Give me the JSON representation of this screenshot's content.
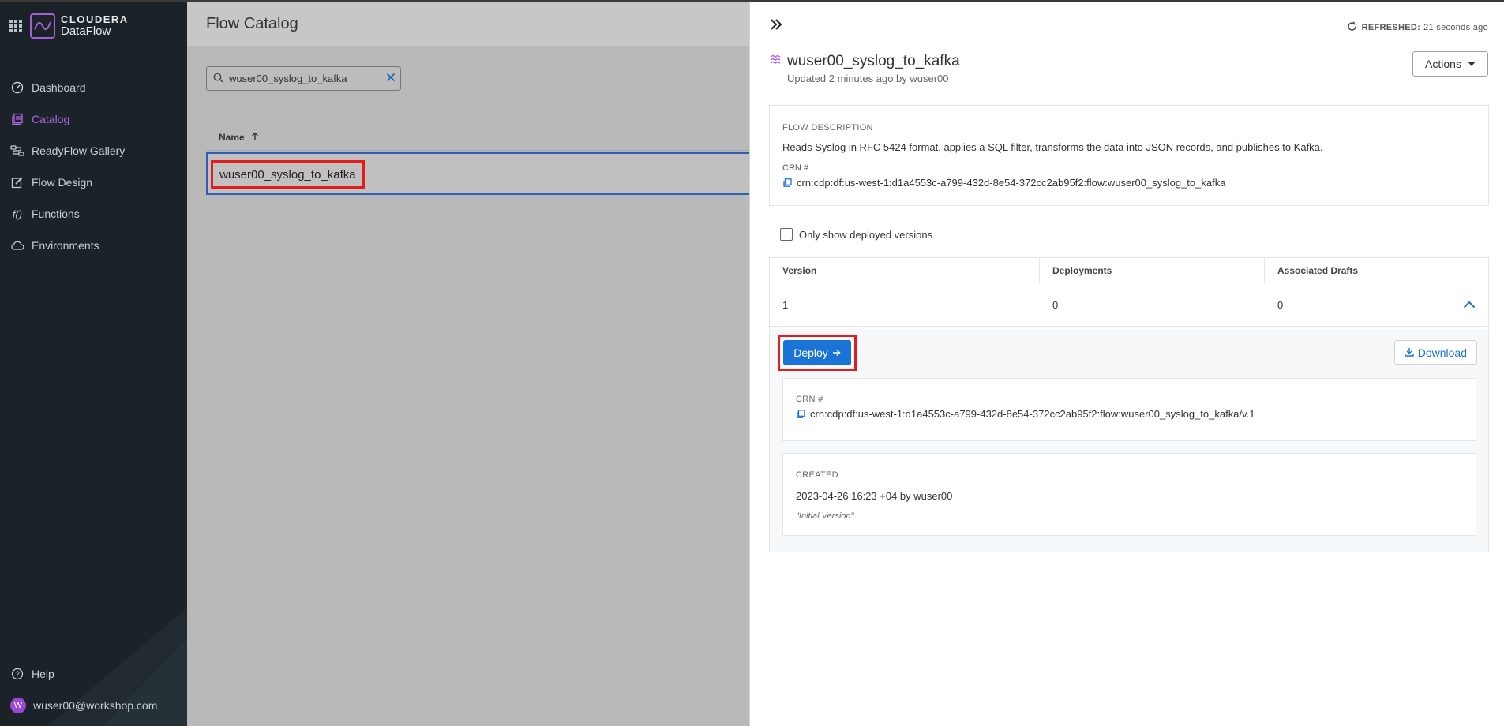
{
  "brand": {
    "line1": "CLOUDERA",
    "line2": "DataFlow"
  },
  "sidebar": {
    "items": [
      {
        "label": "Dashboard",
        "icon": "dashboard-icon",
        "active": false
      },
      {
        "label": "Catalog",
        "icon": "catalog-icon",
        "active": true
      },
      {
        "label": "ReadyFlow Gallery",
        "icon": "readyflow-icon",
        "active": false
      },
      {
        "label": "Flow Design",
        "icon": "flow-design-icon",
        "active": false
      },
      {
        "label": "Functions",
        "icon": "functions-icon",
        "active": false
      },
      {
        "label": "Environments",
        "icon": "cloud-icon",
        "active": false
      }
    ],
    "help": "Help",
    "user": {
      "initial": "W",
      "email": "wuser00@workshop.com"
    }
  },
  "main": {
    "title": "Flow Catalog",
    "search": {
      "value": "wuser00_syslog_to_kafka"
    },
    "table": {
      "header_name": "Name",
      "rows": [
        "wuser00_syslog_to_kafka"
      ]
    }
  },
  "panel": {
    "refreshed_label": "REFRESHED:",
    "refreshed_value": "21 seconds ago",
    "title": "wuser00_syslog_to_kafka",
    "subtitle": "Updated 2 minutes ago by wuser00",
    "actions_label": "Actions",
    "description_label": "FLOW DESCRIPTION",
    "description": "Reads Syslog in RFC 5424 format, applies a SQL filter, transforms the data into JSON records, and publishes to Kafka.",
    "crn_label": "CRN #",
    "crn": "crn:cdp:df:us-west-1:d1a4553c-a799-432d-8e54-372cc2ab95f2:flow:wuser00_syslog_to_kafka",
    "only_deployed_label": "Only show deployed versions",
    "versions": {
      "headers": [
        "Version",
        "Deployments",
        "Associated Drafts"
      ],
      "rows": [
        {
          "version": "1",
          "deployments": "0",
          "drafts": "0"
        }
      ]
    },
    "expanded": {
      "deploy_label": "Deploy",
      "download_label": "Download",
      "crn_label": "CRN #",
      "crn": "crn:cdp:df:us-west-1:d1a4553c-a799-432d-8e54-372cc2ab95f2:flow:wuser00_syslog_to_kafka/v.1",
      "created_label": "CREATED",
      "created": "2023-04-26 16:23 +04 by wuser00",
      "comment": "\"Initial Version\""
    }
  },
  "colors": {
    "accent_purple": "#b264e8",
    "primary_blue": "#1a73d6",
    "highlight_red": "#e01c1c",
    "sidebar_bg": "#1b2329"
  }
}
